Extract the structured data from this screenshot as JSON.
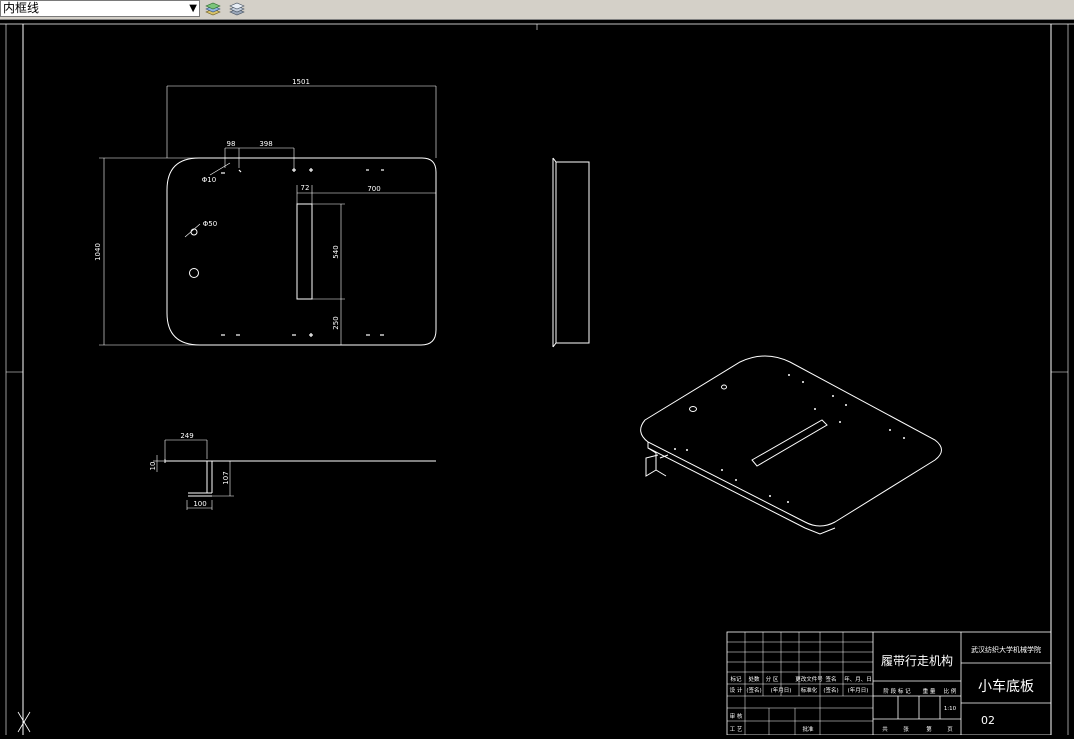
{
  "toolbar": {
    "layer_name": "内框线",
    "icons": [
      "layer-states-icon",
      "layer-properties-icon"
    ]
  },
  "drawing": {
    "dimensions": {
      "overall_width": "1501",
      "offset_a": "98",
      "offset_b": "398",
      "hole_dia_a": "Φ10",
      "slot_width": "72",
      "slot_right": "700",
      "hole_dia_b": "Φ50",
      "overall_height": "1040",
      "slot_length": "540",
      "bottom_offset": "250",
      "profile_length": "249",
      "profile_thickness": "10",
      "profile_height": "107",
      "profile_base": "100"
    },
    "title_block": {
      "project_title": "履带行走机构",
      "school": "武汉纺织大学机械学院",
      "part_name": "小车底板",
      "drawing_no": "02",
      "row1": [
        "标记",
        "处数",
        "分 区",
        "更改文件号",
        "签名",
        "年、月、日"
      ],
      "row2": [
        "设 计",
        "(签名)",
        "(年月日)",
        "标准化",
        "(签名)",
        "(年月日)"
      ],
      "row3_left": "审 核",
      "row4": [
        "工 艺",
        "批准"
      ],
      "stage_header": [
        "阶 段 标 记",
        "重 量",
        "比 例"
      ],
      "scale": "1:10",
      "sheet_row": [
        "共",
        "张",
        "第",
        "页"
      ]
    }
  }
}
